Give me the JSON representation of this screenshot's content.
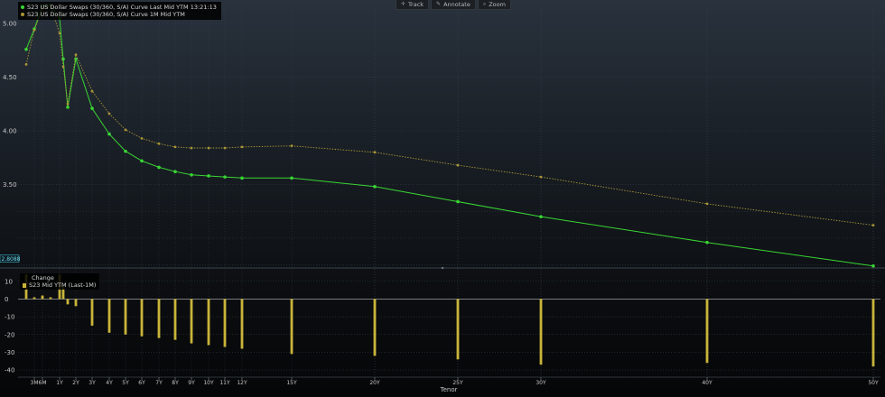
{
  "toolbar": {
    "track": {
      "label": "Track",
      "icon": "crosshair-icon"
    },
    "annotate": {
      "label": "Annotate",
      "icon": "pencil-icon"
    },
    "zoom": {
      "label": "Zoom",
      "icon": "magnifier-icon"
    }
  },
  "colors": {
    "current": "#39d633",
    "previous": "#a89536",
    "bars": "#c9b43a",
    "grid": "#3a4550"
  },
  "chart_data": [
    {
      "type": "line",
      "legend_placement": "top-left",
      "grid": true,
      "xlabel": "Tenor",
      "ylim": [
        2.73,
        5.22
      ],
      "yticks": [
        "5.00",
        "4.50",
        "4.00",
        "3.50"
      ],
      "current_value_label": "2.8088",
      "categories": [
        "3M",
        "6M",
        "1Y",
        "2Y",
        "3Y",
        "4Y",
        "5Y",
        "6Y",
        "7Y",
        "8Y",
        "9Y",
        "10Y",
        "11Y",
        "12Y",
        "15Y",
        "20Y",
        "25Y",
        "30Y",
        "40Y",
        "50Y"
      ],
      "series": [
        {
          "name": "S23 US Dollar Swaps (30/360, S/A) Curve Last Mid YTM 13:21:13",
          "points": [
            {
              "tenor_years": 0.083,
              "y": 4.76
            },
            {
              "tenor_years": 0.25,
              "y": 4.95
            },
            {
              "tenor_years": 0.5,
              "y": 5.16
            },
            {
              "tenor_years": 0.75,
              "y": 5.17
            },
            {
              "tenor_years": 1.0,
              "y": 5.05
            },
            {
              "tenor_years": 1.25,
              "y": 4.67
            },
            {
              "tenor_years": 1.5,
              "y": 4.22
            },
            {
              "tenor_years": 2,
              "y": 4.67
            },
            {
              "tenor_years": 3,
              "y": 4.21
            },
            {
              "tenor_years": 4,
              "y": 3.97
            },
            {
              "tenor_years": 5,
              "y": 3.81
            },
            {
              "tenor_years": 6,
              "y": 3.72
            },
            {
              "tenor_years": 7,
              "y": 3.66
            },
            {
              "tenor_years": 8,
              "y": 3.62
            },
            {
              "tenor_years": 9,
              "y": 3.59
            },
            {
              "tenor_years": 10,
              "y": 3.58
            },
            {
              "tenor_years": 11,
              "y": 3.57
            },
            {
              "tenor_years": 12,
              "y": 3.56
            },
            {
              "tenor_years": 15,
              "y": 3.56
            },
            {
              "tenor_years": 20,
              "y": 3.48
            },
            {
              "tenor_years": 25,
              "y": 3.34
            },
            {
              "tenor_years": 30,
              "y": 3.2
            },
            {
              "tenor_years": 40,
              "y": 2.96
            },
            {
              "tenor_years": 50,
              "y": 2.74
            }
          ]
        },
        {
          "name": "S23 US Dollar Swaps (30/360, S/A) Curve 1M Mid YTM",
          "points": [
            {
              "tenor_years": 0.083,
              "y": 4.62
            },
            {
              "tenor_years": 0.25,
              "y": 4.94
            },
            {
              "tenor_years": 0.5,
              "y": 5.14
            },
            {
              "tenor_years": 0.75,
              "y": 5.16
            },
            {
              "tenor_years": 1.0,
              "y": 4.91
            },
            {
              "tenor_years": 1.25,
              "y": 4.6
            },
            {
              "tenor_years": 1.5,
              "y": 4.25
            },
            {
              "tenor_years": 2,
              "y": 4.71
            },
            {
              "tenor_years": 3,
              "y": 4.37
            },
            {
              "tenor_years": 4,
              "y": 4.16
            },
            {
              "tenor_years": 5,
              "y": 4.01
            },
            {
              "tenor_years": 6,
              "y": 3.93
            },
            {
              "tenor_years": 7,
              "y": 3.88
            },
            {
              "tenor_years": 8,
              "y": 3.85
            },
            {
              "tenor_years": 9,
              "y": 3.84
            },
            {
              "tenor_years": 10,
              "y": 3.84
            },
            {
              "tenor_years": 11,
              "y": 3.84
            },
            {
              "tenor_years": 12,
              "y": 3.85
            },
            {
              "tenor_years": 15,
              "y": 3.86
            },
            {
              "tenor_years": 20,
              "y": 3.8
            },
            {
              "tenor_years": 25,
              "y": 3.68
            },
            {
              "tenor_years": 30,
              "y": 3.57
            },
            {
              "tenor_years": 40,
              "y": 3.32
            },
            {
              "tenor_years": 50,
              "y": 3.12
            }
          ]
        }
      ]
    },
    {
      "type": "bar",
      "title": "Change",
      "xlabel": "Tenor",
      "ylim": [
        -42,
        16
      ],
      "yticks": [
        "10",
        "0",
        "-10",
        "-20",
        "-30",
        "-40"
      ],
      "legend_placement": "top-left",
      "series": [
        {
          "name": "S23 Mid YTM (Last-1M)",
          "points": [
            {
              "tenor_years": 0.083,
              "y": 14
            },
            {
              "tenor_years": 0.25,
              "y": 1
            },
            {
              "tenor_years": 0.5,
              "y": 2
            },
            {
              "tenor_years": 0.75,
              "y": 1
            },
            {
              "tenor_years": 1.0,
              "y": 14
            },
            {
              "tenor_years": 1.25,
              "y": 7
            },
            {
              "tenor_years": 1.5,
              "y": -3
            },
            {
              "tenor_years": 2,
              "y": -4
            },
            {
              "tenor_years": 3,
              "y": -15
            },
            {
              "tenor_years": 4,
              "y": -19
            },
            {
              "tenor_years": 5,
              "y": -20
            },
            {
              "tenor_years": 6,
              "y": -21
            },
            {
              "tenor_years": 7,
              "y": -22
            },
            {
              "tenor_years": 8,
              "y": -23
            },
            {
              "tenor_years": 9,
              "y": -25
            },
            {
              "tenor_years": 10,
              "y": -26
            },
            {
              "tenor_years": 11,
              "y": -27
            },
            {
              "tenor_years": 12,
              "y": -28
            },
            {
              "tenor_years": 15,
              "y": -31
            },
            {
              "tenor_years": 20,
              "y": -32
            },
            {
              "tenor_years": 25,
              "y": -34
            },
            {
              "tenor_years": 30,
              "y": -37
            },
            {
              "tenor_years": 40,
              "y": -36
            },
            {
              "tenor_years": 50,
              "y": -38
            }
          ]
        }
      ]
    }
  ]
}
